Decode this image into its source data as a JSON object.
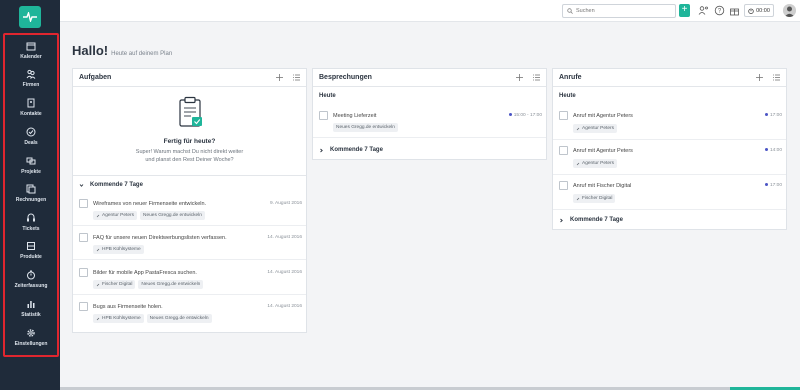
{
  "sidebar": {
    "items": [
      {
        "label": "Kalender",
        "icon": "calendar-icon"
      },
      {
        "label": "Firmen",
        "icon": "company-icon"
      },
      {
        "label": "Kontakte",
        "icon": "contacts-icon"
      },
      {
        "label": "Deals",
        "icon": "deals-icon"
      },
      {
        "label": "Projekte",
        "icon": "projects-icon"
      },
      {
        "label": "Rechnungen",
        "icon": "invoices-icon"
      },
      {
        "label": "Tickets",
        "icon": "tickets-icon"
      },
      {
        "label": "Produkte",
        "icon": "products-icon"
      },
      {
        "label": "Zeiterfassung",
        "icon": "stopwatch-icon"
      },
      {
        "label": "Statistik",
        "icon": "statistics-icon"
      },
      {
        "label": "Einstellungen",
        "icon": "gear-icon"
      }
    ]
  },
  "topbar": {
    "search_placeholder": "Suchen",
    "add_label": "+",
    "timer": "00:00"
  },
  "greeting": {
    "title": "Hallo!",
    "subtitle": "Heute auf deinem Plan"
  },
  "tasks": {
    "title": "Aufgaben",
    "empty_title": "Fertig für heute?",
    "empty_text_1": "Super! Warum machst Du nicht direkt weiter",
    "empty_text_2": "und planst den Rest Deiner Woche?",
    "upcoming_label": "Kommende 7 Tage",
    "items": [
      {
        "text": "Wireframes von neuer Firmenseite entwickeln.",
        "date": "9. August 2016",
        "tags": [
          "Agentur Peters",
          "Neues Gregg.de entwickeln"
        ]
      },
      {
        "text": "FAQ für unsere neuen Direktwerbungslisten verfassen.",
        "date": "14. August 2016",
        "tags": [
          "HPB Kühlsysteme"
        ]
      },
      {
        "text": "Bilder für mobile App PastaFresca suchen.",
        "date": "14. August 2016",
        "tags": [
          "Fischer Digital",
          "Neues Gregg.de entwickeln"
        ]
      },
      {
        "text": "Bugs aus Firmenseite holen.",
        "date": "14. August 2016",
        "tags": [
          "HPB Kühlsysteme",
          "Neues Gregg.de entwickeln"
        ]
      }
    ]
  },
  "meetings": {
    "title": "Besprechungen",
    "today_label": "Heute",
    "upcoming_label": "Kommende 7 Tage",
    "items": [
      {
        "text": "Meeting Lieferzeit",
        "time": "15:00 - 17:00",
        "tags": [
          "Neues Gregg.de entwickeln"
        ]
      }
    ]
  },
  "calls": {
    "title": "Anrufe",
    "today_label": "Heute",
    "upcoming_label": "Kommende 7 Tage",
    "items": [
      {
        "text": "Anruf mit Agentur Peters",
        "time": "17:00",
        "tags": [
          "Agentur Peters"
        ]
      },
      {
        "text": "Anruf mit Agentur Peters",
        "time": "14:00",
        "tags": [
          "Agentur Peters"
        ]
      },
      {
        "text": "Anruf mit Fischer Digital",
        "time": "17:00",
        "tags": [
          "Fischer Digital"
        ]
      }
    ]
  },
  "colors": {
    "sidebar_bg": "#1f2b3a",
    "accent": "#1fb59a",
    "highlight_frame": "#e0262f",
    "time_dot": "#4b55c5"
  }
}
